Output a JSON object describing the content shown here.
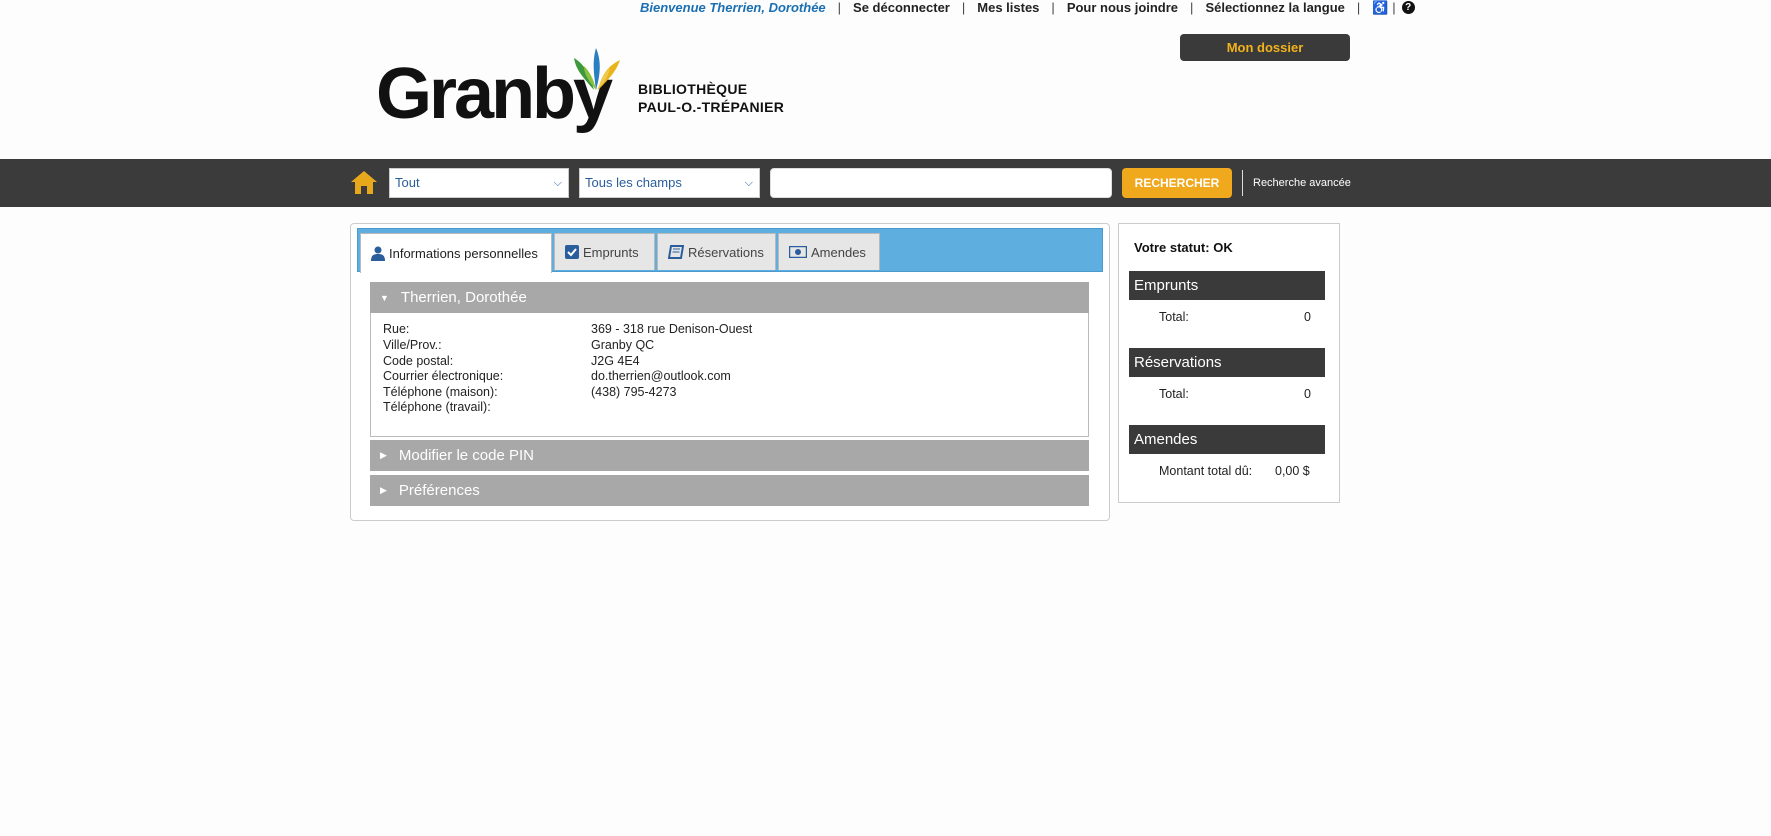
{
  "topbar": {
    "welcome": "Bienvenue Therrien, Dorothée",
    "logout": "Se déconnecter",
    "lists": "Mes listes",
    "contact": "Pour nous joindre",
    "language": "Sélectionnez la langue",
    "accessibility_icon": "wheelchair-icon",
    "help_icon": "question-icon",
    "separator": "|"
  },
  "header": {
    "my_account_button": "Mon dossier",
    "logo_word": "Granby",
    "library_line1": "BIBLIOTHÈQUE",
    "library_line2": "PAUL-O.-TRÉPANIER"
  },
  "search": {
    "scope_select": "Tout",
    "field_select": "Tous les champs",
    "query_value": "",
    "search_button": "RECHERCHER",
    "advanced_link": "Recherche avancée"
  },
  "tabs": [
    {
      "label": "Informations personnelles",
      "icon": "user-icon",
      "active": true
    },
    {
      "label": "Emprunts",
      "icon": "check-icon",
      "active": false
    },
    {
      "label": "Réservations",
      "icon": "book-icon",
      "active": false
    },
    {
      "label": "Amendes",
      "icon": "money-icon",
      "active": false
    }
  ],
  "personal": {
    "name_header": "Therrien, Dorothée",
    "fields": [
      {
        "label": "Rue:",
        "value": "369 - 318 rue Denison-Ouest"
      },
      {
        "label": "Ville/Prov.:",
        "value": "Granby QC"
      },
      {
        "label": "Code postal:",
        "value": "J2G 4E4"
      },
      {
        "label": "Courrier électronique:",
        "value": "do.therrien@outlook.com"
      },
      {
        "label": "Téléphone (maison):",
        "value": "(438) 795-4273"
      },
      {
        "label": "Téléphone (travail):",
        "value": ""
      }
    ],
    "pin_header": "Modifier le code PIN",
    "prefs_header": "Préférences"
  },
  "sidebar": {
    "status": "Votre statut: OK",
    "loans_header": "Emprunts",
    "loans_total_label": "Total:",
    "loans_total_value": "0",
    "holds_header": "Réservations",
    "holds_total_label": "Total:",
    "holds_total_value": "0",
    "fines_header": "Amendes",
    "fines_total_label": "Montant total dû:",
    "fines_total_value": "0,00 $"
  },
  "colors": {
    "accent_orange": "#f0a81c",
    "tab_bar_blue": "#5eaee0",
    "dark_bar": "#3b3b3b",
    "welcome_blue": "#1a6fb3"
  }
}
